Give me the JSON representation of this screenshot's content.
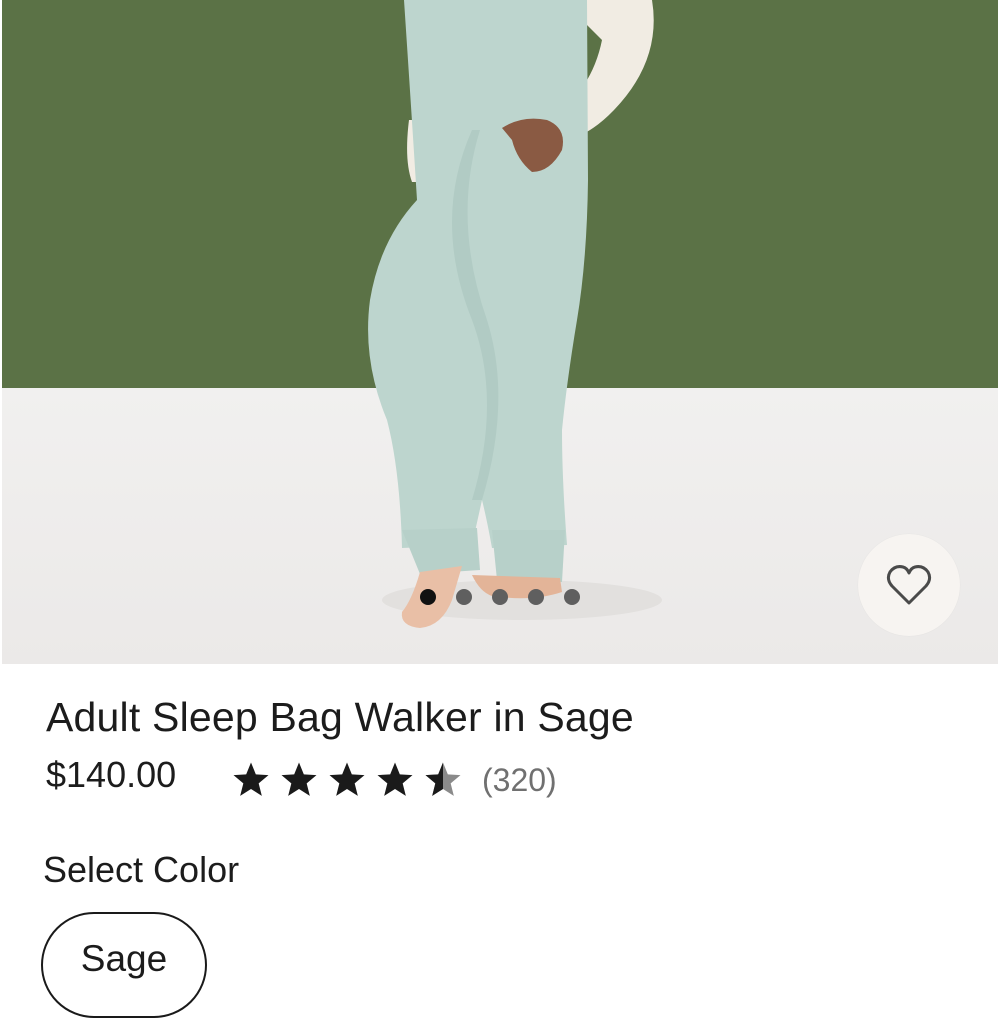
{
  "product": {
    "title": "Adult Sleep Bag Walker in Sage",
    "price": "$140.00",
    "rating": 4.5,
    "rating_max": 5,
    "review_count": "(320)"
  },
  "gallery": {
    "image_count": 5,
    "active_index": 0
  },
  "color_selector": {
    "label": "Select Color",
    "selected": "Sage"
  },
  "icons": {
    "favorite": "heart-outline-icon",
    "star": "star-icon"
  },
  "colors": {
    "wall": "#5b7246",
    "floor": "#f2f1f0",
    "garment": "#bdd5ce",
    "star": "#1a1a1a",
    "star_empty": "#8a8a8a",
    "text_primary": "#1c1c1c",
    "text_muted": "#707070"
  }
}
